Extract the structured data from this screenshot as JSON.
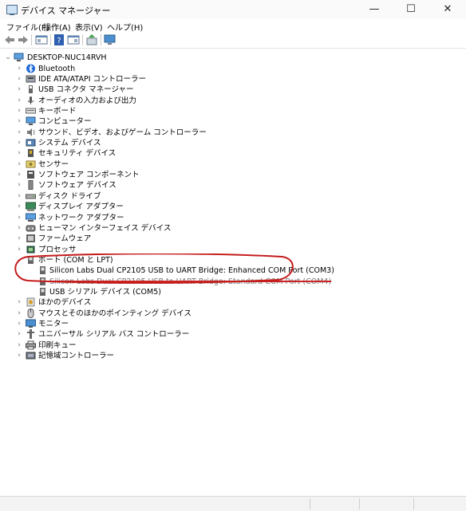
{
  "window": {
    "title": "デバイス マネージャー",
    "minimize": "—",
    "maximize": "☐",
    "close": "✕"
  },
  "menu": [
    "ファイル(F)",
    "操作(A)",
    "表示(V)",
    "ヘルプ(H)"
  ],
  "toolbar": [
    "back-icon",
    "forward-icon",
    "properties-icon",
    "help-icon",
    "view-icon",
    "update-driver-icon",
    "scan-hardware-icon"
  ],
  "tree": {
    "root": "DESKTOP-NUC14RVH",
    "categories": [
      {
        "label": "Bluetooth",
        "icon": "bluetooth-icon",
        "expanded": false
      },
      {
        "label": "IDE ATA/ATAPI コントローラー",
        "icon": "ide-controller-icon",
        "expanded": false
      },
      {
        "label": "USB コネクタ マネージャー",
        "icon": "usb-connector-icon",
        "expanded": false
      },
      {
        "label": "オーディオの入力および出力",
        "icon": "audio-icon",
        "expanded": false
      },
      {
        "label": "キーボード",
        "icon": "keyboard-icon",
        "expanded": false
      },
      {
        "label": "コンピューター",
        "icon": "computer-icon",
        "expanded": false
      },
      {
        "label": "サウンド、ビデオ、およびゲーム コントローラー",
        "icon": "sound-icon",
        "expanded": false
      },
      {
        "label": "システム デバイス",
        "icon": "system-device-icon",
        "expanded": false
      },
      {
        "label": "セキュリティ デバイス",
        "icon": "security-device-icon",
        "expanded": false
      },
      {
        "label": "センサー",
        "icon": "sensor-icon",
        "expanded": false
      },
      {
        "label": "ソフトウェア コンポーネント",
        "icon": "software-component-icon",
        "expanded": false
      },
      {
        "label": "ソフトウェア デバイス",
        "icon": "software-device-icon",
        "expanded": false
      },
      {
        "label": "ディスク ドライブ",
        "icon": "disk-drive-icon",
        "expanded": false
      },
      {
        "label": "ディスプレイ アダプター",
        "icon": "display-adapter-icon",
        "expanded": false
      },
      {
        "label": "ネットワーク アダプター",
        "icon": "network-adapter-icon",
        "expanded": false
      },
      {
        "label": "ヒューマン インターフェイス デバイス",
        "icon": "hid-icon",
        "expanded": false
      },
      {
        "label": "ファームウェア",
        "icon": "firmware-icon",
        "expanded": false
      },
      {
        "label": "プロセッサ",
        "icon": "processor-icon",
        "expanded": false
      },
      {
        "label": "ポート (COM と LPT)",
        "icon": "port-icon",
        "expanded": true,
        "children": [
          "Silicon Labs Dual CP2105 USB to UART Bridge: Enhanced COM Port (COM3)",
          "Silicon Labs Dual CP2105 USB to UART Bridge: Standard COM Port (COM4)",
          "USB シリアル デバイス (COM5)"
        ]
      },
      {
        "label": "ほかのデバイス",
        "icon": "other-device-icon",
        "expanded": false
      },
      {
        "label": "マウスとそのほかのポインティング デバイス",
        "icon": "mouse-icon",
        "expanded": false
      },
      {
        "label": "モニター",
        "icon": "monitor-icon",
        "expanded": false
      },
      {
        "label": "ユニバーサル シリアル バス コントローラー",
        "icon": "usb-controller-icon",
        "expanded": false
      },
      {
        "label": "印刷キュー",
        "icon": "print-queue-icon",
        "expanded": false
      },
      {
        "label": "記憶域コントローラー",
        "icon": "storage-controller-icon",
        "expanded": false
      }
    ]
  },
  "colors": {
    "annotation": "#c41b1b",
    "strike": "#cc2222"
  }
}
